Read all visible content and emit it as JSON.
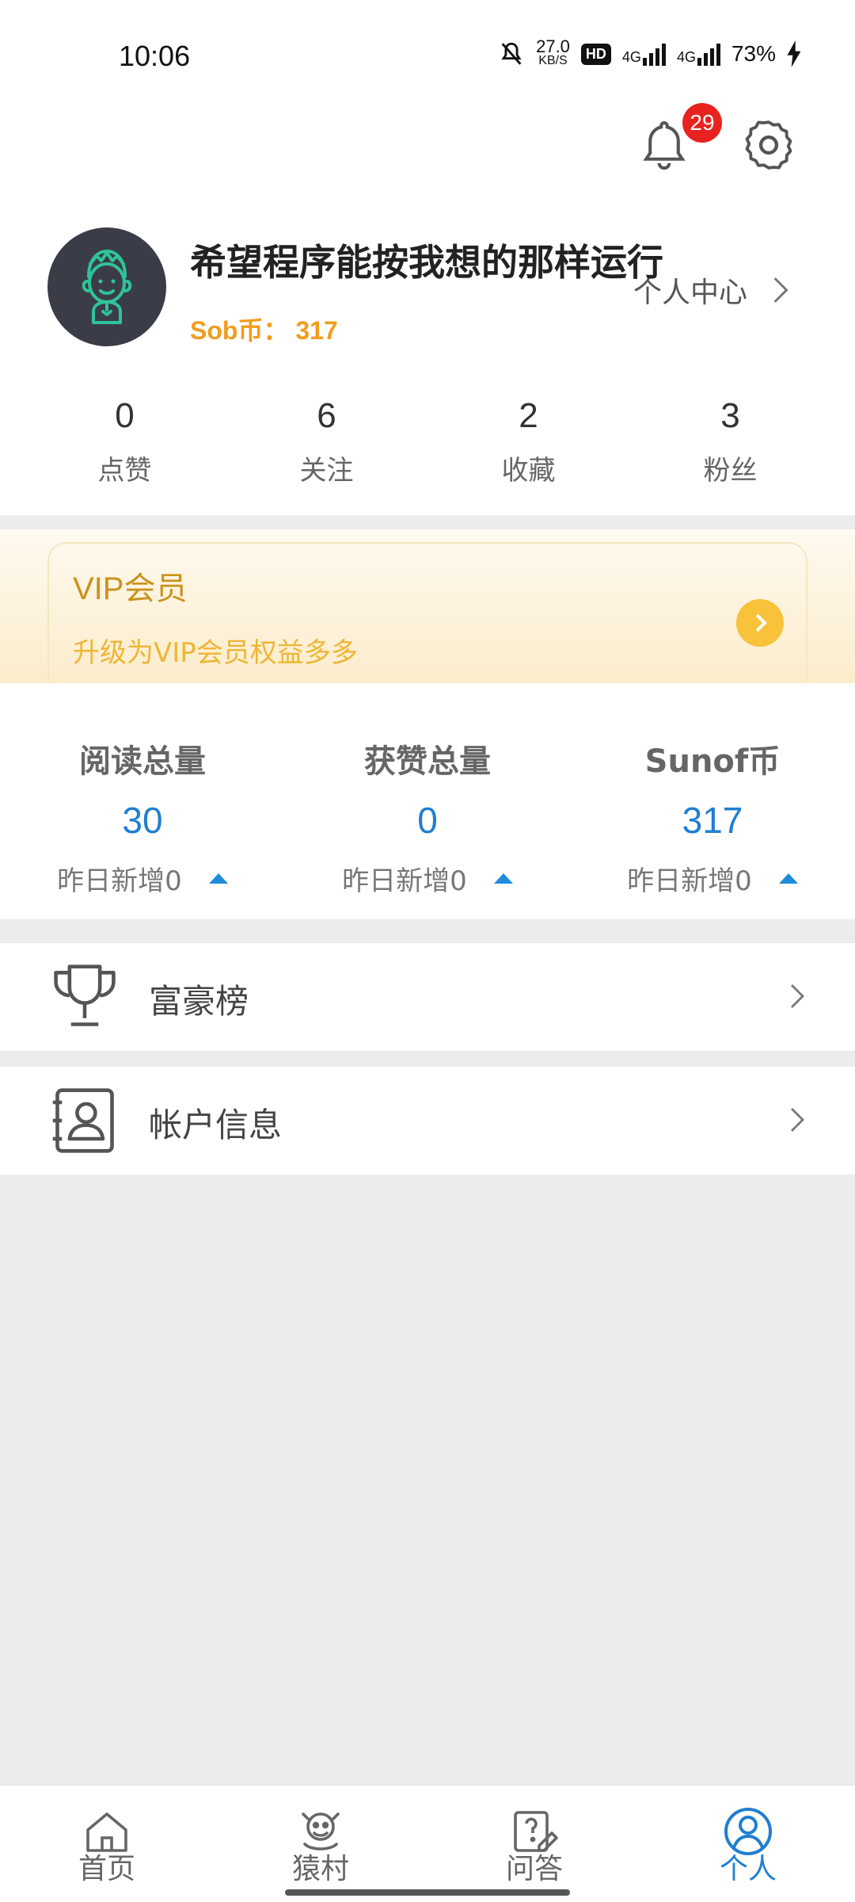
{
  "status": {
    "time": "10:06",
    "net_speed_value": "27.0",
    "net_speed_unit": "KB/S",
    "hd": "HD",
    "sim1": "4G",
    "sim2": "4G",
    "battery": "73%"
  },
  "header": {
    "notification_count": "29",
    "nickname": "希望程序能按我想的那样运行",
    "coins_label": "Sob币：",
    "coins_value": "317",
    "personal_center": "个人中心",
    "icons": [
      "bell-icon",
      "gear-icon",
      "chevron-right-icon"
    ]
  },
  "stats": [
    {
      "value": "0",
      "label": "点赞"
    },
    {
      "value": "6",
      "label": "关注"
    },
    {
      "value": "2",
      "label": "收藏"
    },
    {
      "value": "3",
      "label": "粉丝"
    }
  ],
  "vip": {
    "title": "VIP会员",
    "subtitle": "升级为VIP会员权益多多"
  },
  "totals": [
    {
      "label": "阅读总量",
      "value": "30",
      "increase": "昨日新增0"
    },
    {
      "label": "获赞总量",
      "value": "0",
      "increase": "昨日新增0"
    },
    {
      "label": "Sunof币",
      "value": "317",
      "increase": "昨日新增0"
    }
  ],
  "menu": [
    {
      "label": "富豪榜",
      "icon": "trophy-icon"
    },
    {
      "label": "帐户信息",
      "icon": "account-card-icon"
    }
  ],
  "tabs": [
    {
      "label": "首页",
      "icon": "home-icon",
      "active": false
    },
    {
      "label": "猿村",
      "icon": "monkey-village-icon",
      "active": false
    },
    {
      "label": "问答",
      "icon": "qa-icon",
      "active": false
    },
    {
      "label": "个人",
      "icon": "user-icon",
      "active": true
    }
  ],
  "colors": {
    "accent_blue": "#1f7ed1",
    "coin_orange": "#f29c1f",
    "vip_gold": "#c9931d",
    "badge_red": "#e8231f"
  }
}
